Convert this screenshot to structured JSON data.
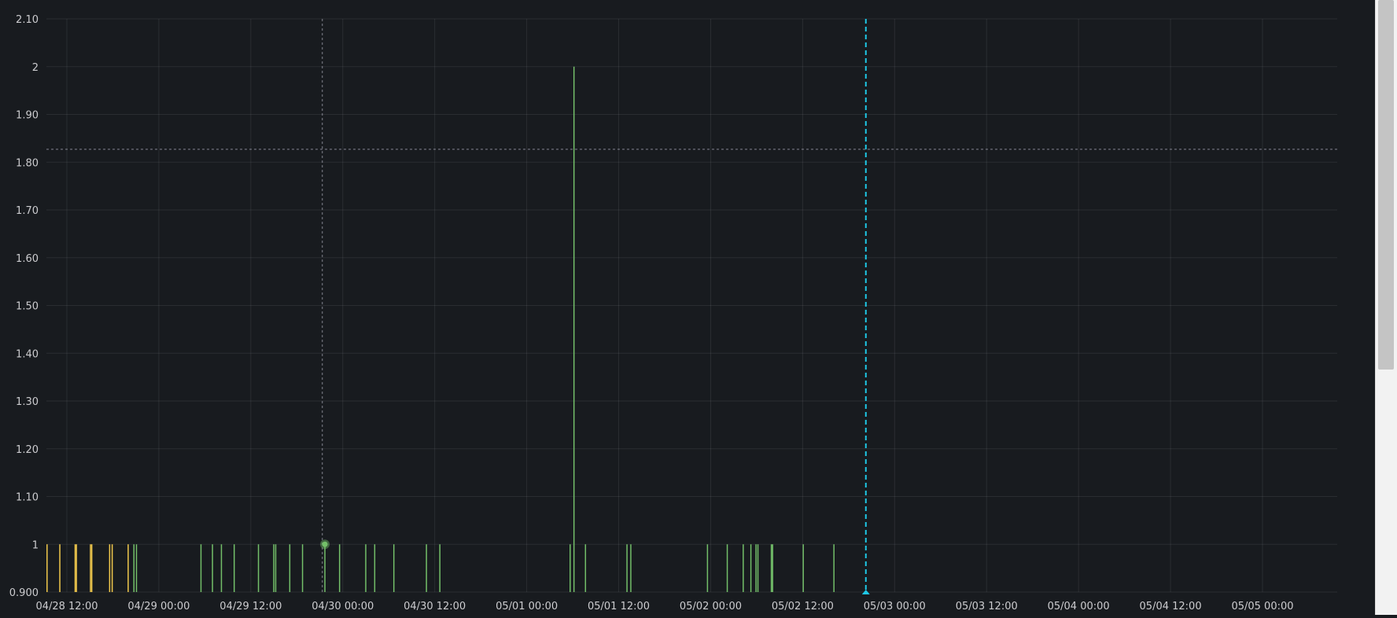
{
  "chart_data": {
    "type": "bar",
    "y_ticks": [
      {
        "value": 2.1,
        "label": "2.10"
      },
      {
        "value": 2.0,
        "label": "2"
      },
      {
        "value": 1.9,
        "label": "1.90"
      },
      {
        "value": 1.8,
        "label": "1.80"
      },
      {
        "value": 1.7,
        "label": "1.70"
      },
      {
        "value": 1.6,
        "label": "1.60"
      },
      {
        "value": 1.5,
        "label": "1.50"
      },
      {
        "value": 1.4,
        "label": "1.40"
      },
      {
        "value": 1.3,
        "label": "1.30"
      },
      {
        "value": 1.2,
        "label": "1.20"
      },
      {
        "value": 1.1,
        "label": "1.10"
      },
      {
        "value": 1.0,
        "label": "1"
      },
      {
        "value": 0.9,
        "label": "0.900"
      }
    ],
    "x_ticks": [
      {
        "time": "04/28 12:00",
        "label": "04/28 12:00"
      },
      {
        "time": "04/29 00:00",
        "label": "04/29 00:00"
      },
      {
        "time": "04/29 12:00",
        "label": "04/29 12:00"
      },
      {
        "time": "04/30 00:00",
        "label": "04/30 00:00"
      },
      {
        "time": "04/30 12:00",
        "label": "04/30 12:00"
      },
      {
        "time": "05/01 00:00",
        "label": "05/01 00:00"
      },
      {
        "time": "05/01 12:00",
        "label": "05/01 12:00"
      },
      {
        "time": "05/02 00:00",
        "label": "05/02 00:00"
      },
      {
        "time": "05/02 12:00",
        "label": "05/02 12:00"
      },
      {
        "time": "05/03 00:00",
        "label": "05/03 00:00"
      },
      {
        "time": "05/03 12:00",
        "label": "05/03 12:00"
      },
      {
        "time": "05/04 00:00",
        "label": "05/04 00:00"
      },
      {
        "time": "05/04 12:00",
        "label": "05/04 12:00"
      },
      {
        "time": "05/05 00:00",
        "label": "05/05 00:00"
      }
    ],
    "x_range": [
      "04/28 09:20",
      "05/05 09:45"
    ],
    "ylim": [
      0.9,
      2.1
    ],
    "grid": true,
    "series": [
      {
        "color": "#f2c94c",
        "points": [
          {
            "time": "04/28 09:25",
            "value": 1
          },
          {
            "time": "04/28 11:05",
            "value": 1
          },
          {
            "time": "04/28 13:05",
            "value": 1
          },
          {
            "time": "04/28 13:15",
            "value": 1
          },
          {
            "time": "04/28 15:05",
            "value": 1
          },
          {
            "time": "04/28 15:15",
            "value": 1
          },
          {
            "time": "04/28 17:35",
            "value": 1
          },
          {
            "time": "04/28 17:55",
            "value": 1
          },
          {
            "time": "04/28 20:00",
            "value": 1
          }
        ]
      },
      {
        "color": "#73bf69",
        "points": [
          {
            "time": "04/28 20:45",
            "value": 1
          },
          {
            "time": "04/28 21:05",
            "value": 1
          },
          {
            "time": "04/29 05:30",
            "value": 1
          },
          {
            "time": "04/29 07:00",
            "value": 1
          },
          {
            "time": "04/29 08:10",
            "value": 1
          },
          {
            "time": "04/29 09:50",
            "value": 1
          },
          {
            "time": "04/29 13:00",
            "value": 1
          },
          {
            "time": "04/29 15:00",
            "value": 1
          },
          {
            "time": "04/29 15:15",
            "value": 1
          },
          {
            "time": "04/29 17:05",
            "value": 1
          },
          {
            "time": "04/29 18:45",
            "value": 1
          },
          {
            "time": "04/29 21:40",
            "value": 1
          },
          {
            "time": "04/29 23:35",
            "value": 1
          },
          {
            "time": "04/30 03:00",
            "value": 1
          },
          {
            "time": "04/30 04:10",
            "value": 1
          },
          {
            "time": "04/30 06:40",
            "value": 1
          },
          {
            "time": "04/30 10:55",
            "value": 1
          },
          {
            "time": "04/30 12:40",
            "value": 1
          },
          {
            "time": "05/01 05:40",
            "value": 1
          },
          {
            "time": "05/01 06:10",
            "value": 2
          },
          {
            "time": "05/01 07:40",
            "value": 1
          },
          {
            "time": "05/01 13:05",
            "value": 1
          },
          {
            "time": "05/01 13:35",
            "value": 1
          },
          {
            "time": "05/01 23:35",
            "value": 1
          },
          {
            "time": "05/02 02:10",
            "value": 1
          },
          {
            "time": "05/02 04:15",
            "value": 1
          },
          {
            "time": "05/02 05:15",
            "value": 1
          },
          {
            "time": "05/02 05:55",
            "value": 1
          },
          {
            "time": "05/02 06:10",
            "value": 1
          },
          {
            "time": "05/02 07:55",
            "value": 1
          },
          {
            "time": "05/02 08:05",
            "value": 1
          },
          {
            "time": "05/02 12:05",
            "value": 1
          },
          {
            "time": "05/02 16:05",
            "value": 1
          }
        ]
      }
    ],
    "highlight_point": {
      "time": "04/29 21:40",
      "value": 1
    },
    "crosshair": {
      "time": "04/29 21:20",
      "value": 1.827
    },
    "marker": {
      "time": "05/02 20:15",
      "color": "#1ec8e6"
    }
  }
}
